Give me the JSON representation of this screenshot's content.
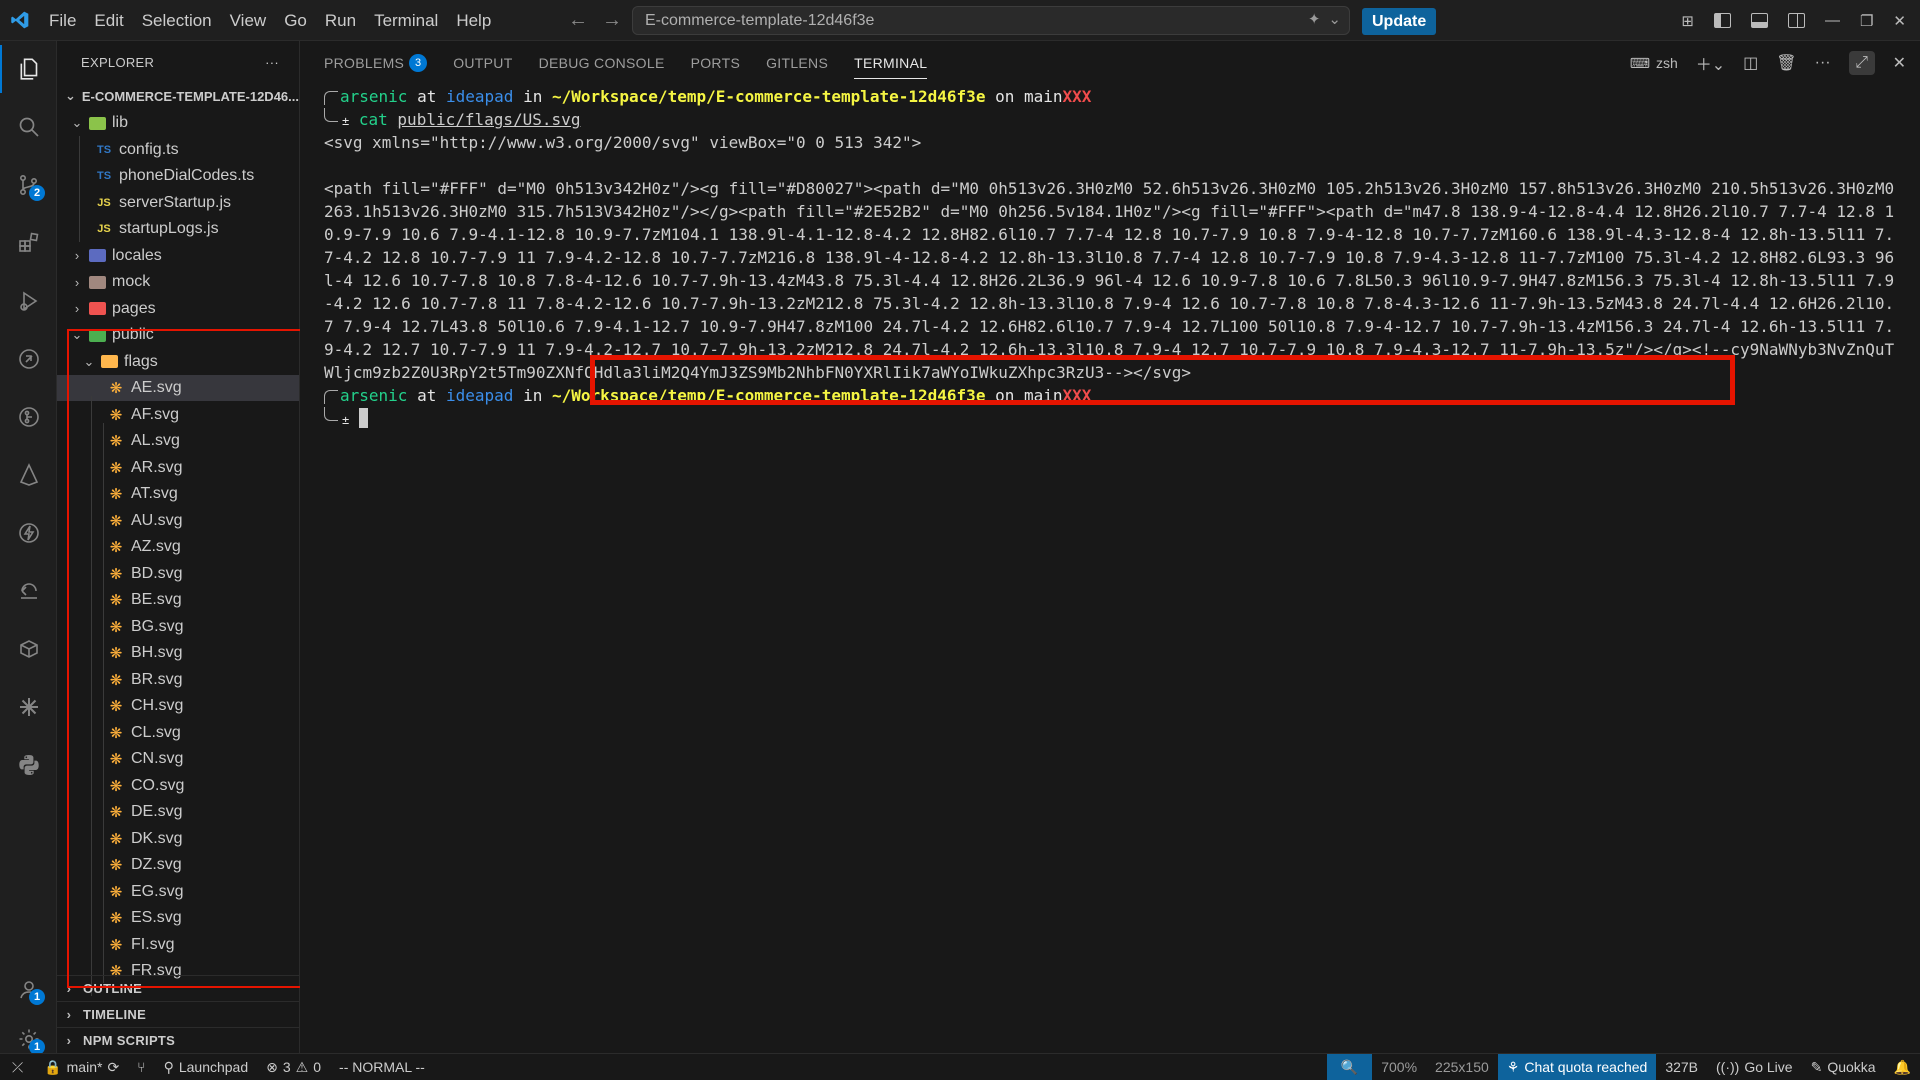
{
  "titlebar": {
    "menu": [
      "File",
      "Edit",
      "Selection",
      "View",
      "Go",
      "Run",
      "Terminal",
      "Help"
    ],
    "command_center": "E-commerce-template-12d46f3e",
    "update_label": "Update"
  },
  "activity_bar": {
    "icons": [
      "explorer-icon",
      "search-icon",
      "source-control-icon",
      "extensions-icon",
      "run-debug-icon",
      "remote-explorer-icon",
      "gitlens-icon",
      "prisma-icon",
      "thunder-client-icon",
      "gitlens-inspect-icon",
      "docker-icon",
      "copilot-icon",
      "python-icon"
    ],
    "badges": {
      "source_control": "2",
      "accounts": "1",
      "settings": "1"
    }
  },
  "sidebar": {
    "title": "EXPLORER",
    "more": "···",
    "root": "E-COMMERCE-TEMPLATE-12D46...",
    "tree": [
      {
        "label": "lib",
        "type": "folder-open",
        "depth": 1
      },
      {
        "label": "config.ts",
        "type": "ts",
        "depth": 2
      },
      {
        "label": "phoneDialCodes.ts",
        "type": "ts",
        "depth": 2
      },
      {
        "label": "serverStartup.js",
        "type": "js",
        "depth": 2
      },
      {
        "label": "startupLogs.js",
        "type": "js",
        "depth": 2
      },
      {
        "label": "locales",
        "type": "folder",
        "depth": 1
      },
      {
        "label": "mock",
        "type": "folder",
        "depth": 1
      },
      {
        "label": "pages",
        "type": "folder",
        "depth": 1
      },
      {
        "label": "public",
        "type": "folder-open",
        "depth": 1
      },
      {
        "label": "flags",
        "type": "folder-open",
        "depth": 2
      },
      {
        "label": "AE.svg",
        "type": "svg",
        "depth": 3,
        "selected": true
      },
      {
        "label": "AF.svg",
        "type": "svg",
        "depth": 3
      },
      {
        "label": "AL.svg",
        "type": "svg",
        "depth": 3
      },
      {
        "label": "AR.svg",
        "type": "svg",
        "depth": 3
      },
      {
        "label": "AT.svg",
        "type": "svg",
        "depth": 3
      },
      {
        "label": "AU.svg",
        "type": "svg",
        "depth": 3
      },
      {
        "label": "AZ.svg",
        "type": "svg",
        "depth": 3
      },
      {
        "label": "BD.svg",
        "type": "svg",
        "depth": 3
      },
      {
        "label": "BE.svg",
        "type": "svg",
        "depth": 3
      },
      {
        "label": "BG.svg",
        "type": "svg",
        "depth": 3
      },
      {
        "label": "BH.svg",
        "type": "svg",
        "depth": 3
      },
      {
        "label": "BR.svg",
        "type": "svg",
        "depth": 3
      },
      {
        "label": "CH.svg",
        "type": "svg",
        "depth": 3
      },
      {
        "label": "CL.svg",
        "type": "svg",
        "depth": 3
      },
      {
        "label": "CN.svg",
        "type": "svg",
        "depth": 3
      },
      {
        "label": "CO.svg",
        "type": "svg",
        "depth": 3
      },
      {
        "label": "DE.svg",
        "type": "svg",
        "depth": 3
      },
      {
        "label": "DK.svg",
        "type": "svg",
        "depth": 3
      },
      {
        "label": "DZ.svg",
        "type": "svg",
        "depth": 3
      },
      {
        "label": "EG.svg",
        "type": "svg",
        "depth": 3
      },
      {
        "label": "ES.svg",
        "type": "svg",
        "depth": 3
      },
      {
        "label": "FI.svg",
        "type": "svg",
        "depth": 3
      },
      {
        "label": "FR.svg",
        "type": "svg",
        "depth": 3
      }
    ],
    "sections": [
      "OUTLINE",
      "TIMELINE",
      "NPM SCRIPTS"
    ]
  },
  "panel": {
    "tabs": [
      {
        "label": "PROBLEMS",
        "badge": "3"
      },
      {
        "label": "OUTPUT"
      },
      {
        "label": "DEBUG CONSOLE"
      },
      {
        "label": "PORTS"
      },
      {
        "label": "GITLENS"
      },
      {
        "label": "TERMINAL",
        "active": true
      }
    ],
    "shell": "zsh"
  },
  "terminal": {
    "prompt": {
      "user": "arsenic",
      "at": "at",
      "host": "ideapad",
      "in": "in",
      "path": "~/Workspace/temp/E-commerce-template-12d46f3e",
      "on": "on",
      "branch": "main",
      "dirty": "XXX",
      "sym": "±"
    },
    "command": "cat",
    "command_arg": "public/flags/US.svg",
    "svg_open": "<svg xmlns=\"http://www.w3.org/2000/svg\" viewBox=\"0 0 513 342\">",
    "svg_body": "<path fill=\"#FFF\" d=\"M0 0h513v342H0z\"/><g fill=\"#D80027\"><path d=\"M0 0h513v26.3H0zM0 52.6h513v26.3H0zM0 105.2h513v26.3H0zM0 157.8h513v26.3H0zM0 210.5h513v26.3H0zM0 263.1h513v26.3H0zM0 315.7h513V342H0z\"/></g><path fill=\"#2E52B2\" d=\"M0 0h256.5v184.1H0z\"/><g fill=\"#FFF\"><path d=\"m47.8 138.9-4-12.8-4.4 12.8H26.2l10.7 7.7-4 12.8 10.9-7.9 10.6 7.9-4.1-12.8 10.9-7.7zM104.1 138.9l-4.1-12.8-4.2 12.8H82.6l10.7 7.7-4 12.8 10.7-7.9 10.8 7.9-4-12.8 10.7-7.7zM160.6 138.9l-4.3-12.8-4 12.8h-13.5l11 7.7-4.2 12.8 10.7-7.9 11 7.9-4.2-12.8 10.7-7.7zM216.8 138.9l-4-12.8-4.2 12.8h-13.3l10.8 7.7-4 12.8 10.7-7.9 10.8 7.9-4.3-12.8 11-7.7zM100 75.3l-4.2 12.8H82.6L93.3 96l-4 12.6 10.7-7.8 10.8 7.8-4-12.6 10.7-7.9h-13.4zM43.8 75.3l-4.4 12.8H26.2L36.9 96l-4 12.6 10.9-7.8 10.6 7.8L50.3 96l10.9-7.9H47.8zM156.3 75.3l-4 12.8h-13.5l11 7.9-4.2 12.6 10.7-7.8 11 7.8-4.2-12.6 10.7-7.9h-13.2zM212.8 75.3l-4.2 12.8h-13.3l10.8 7.9-4 12.6 10.7-7.8 10.8 7.8-4.3-12.6 11-7.9h-13.5zM43.8 24.7l-4.4 12.6H26.2l10.7 7.9-4 12.7L43.8 50l10.6 7.9-4.1-12.7 10.9-7.9H47.8zM100 24.7l-4.2 12.6H82.6l10.7 7.9-4 12.7L100 50l10.8 7.9-4-12.7 10.7-7.9h-13.4zM156.3 24.7l-4 12.6h-13.5l11 7.9-4.2 12.7 10.7-7.9 11 7.9-4.2-12.7 10.7-7.9h-13.2zM212.8 24.7l-4.2 12.6h-13.3l10.8 7.9-4 12.7 10.7-7.9 10.8 7.9-4.3-12.7 11-7.9h-13.5z\"/></g>",
    "svg_tail": "<!--cy9NaWNyb3NvZnQuTWljcm9zb2Z0U3RpY2t5Tm90ZXNfOHdla3liM2Q4YmJ3ZS9Mb2NhbFN0YXRlIik7aWYoIWkuZXhpc3RzU3--></svg>"
  },
  "statusbar": {
    "branch": "main*",
    "launchpad": "Launchpad",
    "errors": "3",
    "warnings": "0",
    "vim_mode": "-- NORMAL --",
    "zoom": "700%",
    "dimensions": "225x150",
    "chat": "Chat quota reached",
    "size": "327B",
    "golive": "Go Live",
    "quokka": "Quokka"
  }
}
